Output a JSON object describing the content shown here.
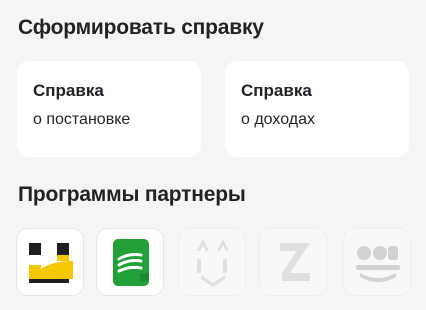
{
  "certificates": {
    "title": "Сформировать справку",
    "cards": [
      {
        "title": "Справка",
        "subtitle": "о постановке"
      },
      {
        "title": "Справка",
        "subtitle": "о доходах"
      }
    ]
  },
  "partners": {
    "title": "Программы партнеры",
    "logos": [
      {
        "icon": "yandex-taxi-logo-icon",
        "state": "active"
      },
      {
        "icon": "sber-wallet-logo-icon",
        "state": "active"
      },
      {
        "icon": "partner-logo-3-icon",
        "state": "faded"
      },
      {
        "icon": "partner-logo-4-icon",
        "state": "faded"
      },
      {
        "icon": "partner-logo-5-icon",
        "state": "faded"
      }
    ]
  },
  "colors": {
    "background": "#f4f5f7",
    "card": "#ffffff",
    "text": "#1f2229",
    "taxi_yellow": "#f6c800",
    "sber_green": "#21a038"
  }
}
